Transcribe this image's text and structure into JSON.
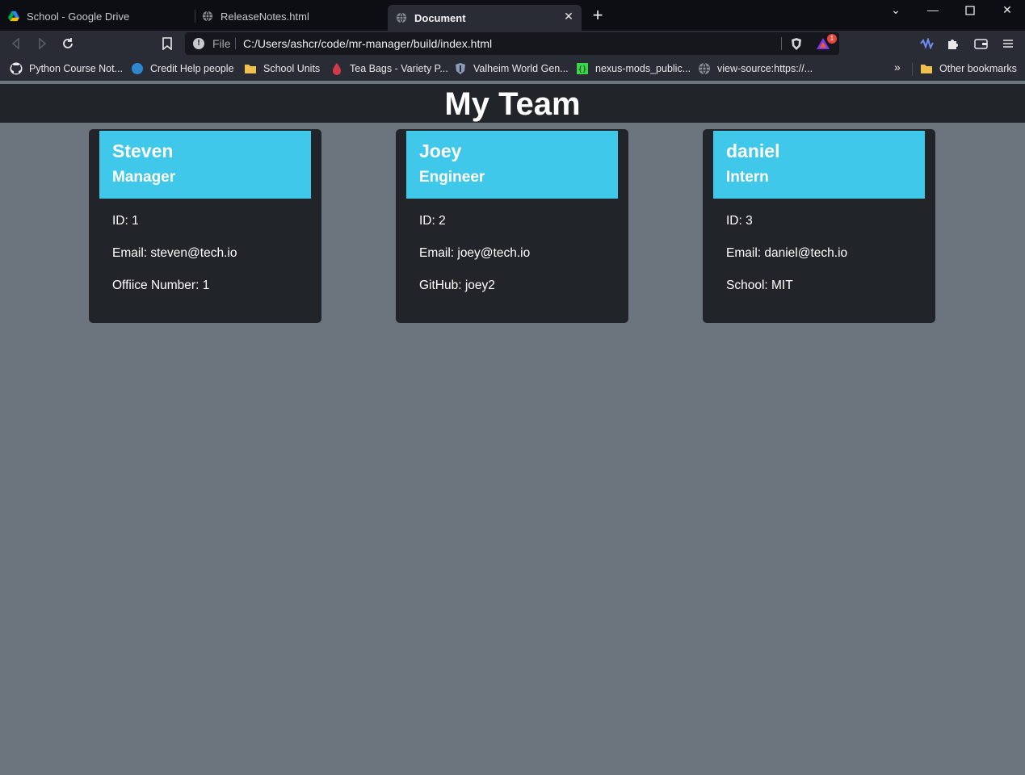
{
  "browser": {
    "tabs": [
      {
        "title": "School - Google Drive",
        "icon": "google-drive-icon",
        "active": false
      },
      {
        "title": "ReleaseNotes.html",
        "icon": "globe-icon",
        "active": false
      },
      {
        "title": "Document",
        "icon": "globe-icon",
        "active": true
      }
    ],
    "address": {
      "scheme": "File",
      "url": "C:/Users/ashcr/code/mr-manager/build/index.html"
    },
    "rewards_badge": "1",
    "bookmarks": [
      {
        "label": "Python Course Not...",
        "icon": "github-icon"
      },
      {
        "label": "Credit Help people",
        "icon": "circle-icon"
      },
      {
        "label": "School Units",
        "icon": "folder-icon"
      },
      {
        "label": "Tea Bags - Variety P...",
        "icon": "tea-icon"
      },
      {
        "label": "Valheim World Gen...",
        "icon": "shield-icon"
      },
      {
        "label": "nexus-mods_public...",
        "icon": "code-icon"
      },
      {
        "label": "view-source:https://...",
        "icon": "globe-icon"
      }
    ],
    "other_bookmarks": "Other bookmarks",
    "more_bookmarks": "»"
  },
  "page": {
    "title": "My Team",
    "cards": [
      {
        "name": "Steven",
        "role": "Manager",
        "lines": [
          "ID: 1",
          "Email: steven@tech.io",
          "Offiice Number: 1"
        ]
      },
      {
        "name": "Joey",
        "role": "Engineer",
        "lines": [
          "ID: 2",
          "Email: joey@tech.io",
          "GitHub: joey2"
        ]
      },
      {
        "name": "daniel",
        "role": "Intern",
        "lines": [
          "ID: 3",
          "Email: daniel@tech.io",
          "School: MIT"
        ]
      }
    ]
  },
  "colors": {
    "page_bg": "#6c757d",
    "card_bg": "#212529",
    "card_header": "#3fc8e9",
    "header_bg": "#212529"
  }
}
